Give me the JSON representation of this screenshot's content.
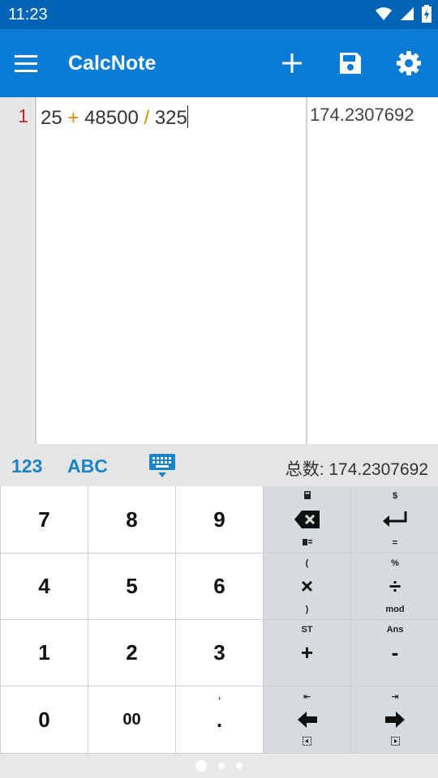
{
  "status_bar": {
    "time": "11:23"
  },
  "app_bar": {
    "title": "CalcNote"
  },
  "editor": {
    "line_number": "1",
    "expression": {
      "a": "25",
      "op1": "+",
      "b": "48500",
      "op2": "/",
      "c": "325"
    },
    "result": "174.2307692"
  },
  "keyboard_header": {
    "mode_numeric": "123",
    "mode_alpha": "ABC",
    "total_label": "总数: 174.2307692"
  },
  "keys": {
    "k7": "7",
    "k8": "8",
    "k9": "9",
    "k4": "4",
    "k5": "5",
    "k6": "6",
    "k1": "1",
    "k2": "2",
    "k3": "3",
    "k0": "0",
    "k00": "00",
    "kdot": ".",
    "kdot_sup": ",",
    "backspace_main": "⌫",
    "enter_sup": "$",
    "enter_sub": "=",
    "mul_main": "×",
    "mul_sup": "(",
    "mul_sub": ")",
    "div_main": "÷",
    "div_sup": "%",
    "div_sub": "mod",
    "plus_main": "+",
    "plus_sup": "ST",
    "minus_main": "-",
    "minus_sup": "Ans",
    "left_sup": "⇤",
    "right_sup": "⇥"
  },
  "colors": {
    "status_bar": "#0064b4",
    "app_bar": "#0a7cd6",
    "accent": "#1a84c8",
    "operator": "#e08a00",
    "line_number": "#c62828"
  }
}
